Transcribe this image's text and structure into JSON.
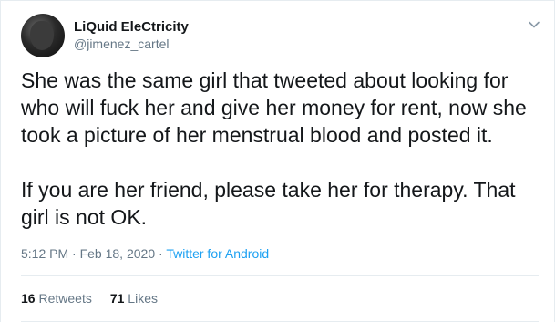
{
  "author": {
    "display_name": "LiQuid EleCtricity",
    "handle": "@jimenez_cartel",
    "avatar": "profile-photo"
  },
  "menu": {
    "icon": "chevron-down-icon"
  },
  "tweet": {
    "paragraphs": [
      "She was the same girl that tweeted about looking for who will fuck her and give her money for rent, now she took a picture of her menstrual blood and posted it.",
      "If you are her friend, please take her for therapy. That girl is not OK."
    ]
  },
  "meta": {
    "time": "5:12 PM",
    "separator": " · ",
    "date": "Feb 18, 2020",
    "source": "Twitter for Android"
  },
  "stats": {
    "retweets_count": "16",
    "retweets_label": "Retweets",
    "likes_count": "71",
    "likes_label": "Likes"
  },
  "colors": {
    "link": "#1da1f2",
    "secondary_text": "#657786",
    "primary_text": "#14171a",
    "border": "#e6ecf0"
  }
}
